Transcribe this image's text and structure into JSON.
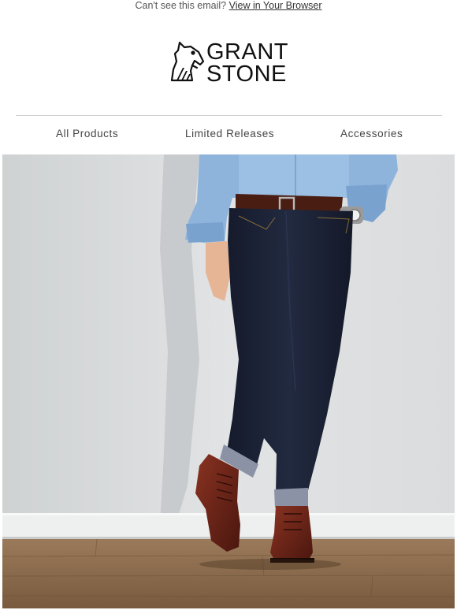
{
  "preheader": {
    "text": "Can't see this email?",
    "link": "View in Your Browser"
  },
  "brand": {
    "line1": "GRANT",
    "line2": "STONE",
    "logo_icon": "horse-head-icon"
  },
  "nav": {
    "items": [
      {
        "label": "All Products"
      },
      {
        "label": "Limited Releases"
      },
      {
        "label": "Accessories"
      }
    ]
  },
  "hero": {
    "image": "man-in-denim-and-leather-boots-photo"
  },
  "colors": {
    "text": "#111111",
    "nav_text": "#444444",
    "divider": "#cfcfcf",
    "wall": "#dadcdd",
    "floor": "#8a6a4c",
    "denim": "#1c2236",
    "shirt": "#8fb4dc",
    "boot": "#6b2317"
  }
}
